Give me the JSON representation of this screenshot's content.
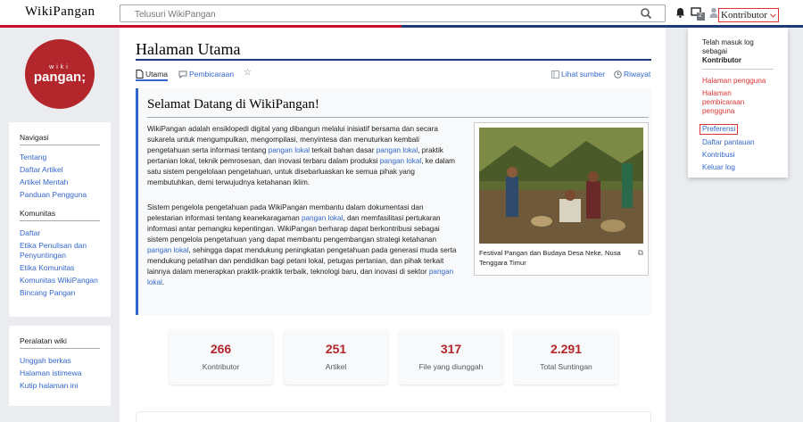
{
  "site": {
    "logo_text": "WikiPangan"
  },
  "search": {
    "placeholder": "Telusuri WikiPangan"
  },
  "header": {
    "user_label": "Kontributor",
    "notif_count": "2"
  },
  "sidebar": {
    "logo_small": "wiki",
    "logo_big": "pangan;",
    "sections": [
      {
        "heading": "Navigasi",
        "items": [
          "Tentang",
          "Daftar Artikel",
          "Artikel Mentah",
          "Panduan Pengguna"
        ]
      },
      {
        "heading": "Komunitas",
        "items": [
          "Daftar",
          "Etika Penulisan dan Penyuntingan",
          "Etika Komunitas",
          "Komunitas WikiPangan",
          "Bincang Pangan"
        ]
      },
      {
        "heading": "Peralatan wiki",
        "items": [
          "Unggah berkas",
          "Halaman istimewa",
          "Kutip halaman ini"
        ]
      }
    ]
  },
  "page": {
    "title": "Halaman Utama",
    "tabs": {
      "main": "Utama",
      "talk": "Pembicaraan",
      "view_source": "Lihat sumber",
      "history": "Riwayat"
    }
  },
  "welcome": {
    "heading": "Selamat Datang di WikiPangan!",
    "p1": [
      {
        "t": "WikiPangan adalah ensiklopedi digital yang dibangun melalui inisiatif bersama dan secara sukarela untuk mengumpulkan, mengompilasi, menyintesa dan menuturkan kembali pengetahuan serta informasi tentang "
      },
      {
        "t": "pangan lokal",
        "link": true
      },
      {
        "t": " terkait bahan dasar "
      },
      {
        "t": "pangan lokal",
        "link": true
      },
      {
        "t": ", praktik pertanian lokal, teknik pemrosesan, dan inovasi terbaru dalam produksi "
      },
      {
        "t": "pangan lokal",
        "link": true
      },
      {
        "t": ", ke dalam satu sistem pengelolaan pengetahuan, untuk disebarluaskan ke semua pihak yang membutuhkan, demi terwujudnya ketahanan iklim."
      }
    ],
    "p2": [
      {
        "t": "Sistem pengelola pengetahuan pada WikiPangan membantu dalam dokumentasi dan pelestarian informasi tentang keanekaragaman "
      },
      {
        "t": "pangan lokal",
        "link": true
      },
      {
        "t": ", dan memfasilitasi pertukaran informasi antar pemangku kepentingan. WikiPangan berharap dapat berkontribusi sebagai sistem pengelola pengetahuan yang dapat membantu pengembangan strategi ketahanan "
      },
      {
        "t": "pangan lokal",
        "link": true
      },
      {
        "t": ", sehingga dapat mendukung peningkatan pengetahuan pada generasi muda serta mendukung pelatihan dan pendidikan bagi petani lokal, petugas pertanian, dan pihak terkait lainnya dalam menerapkan praktik-praktik terbaik, teknologi baru, dan inovasi di sektor "
      },
      {
        "t": "pangan lokal",
        "link": true
      },
      {
        "t": "."
      }
    ],
    "caption": "Festival Pangan dan Budaya Desa Neke, Nusa Tenggara Timur"
  },
  "stats": [
    {
      "value": "266",
      "label": "Kontributor"
    },
    {
      "value": "251",
      "label": "Artikel"
    },
    {
      "value": "317",
      "label": "File yang diunggah"
    },
    {
      "value": "2.291",
      "label": "Total Suntingan"
    }
  ],
  "user_menu": {
    "logged_in_text": "Telah masuk log sebagai",
    "username": "Kontributor",
    "links": [
      "Halaman pengguna",
      "Halaman pembicaraan pengguna",
      "Preferensi",
      "Daftar pantauan",
      "Kontribusi",
      "Keluar log"
    ]
  },
  "colors": {
    "brand_red": "#b3262c",
    "link_blue": "#3366cc",
    "nav_blue": "#1f3a7a"
  }
}
